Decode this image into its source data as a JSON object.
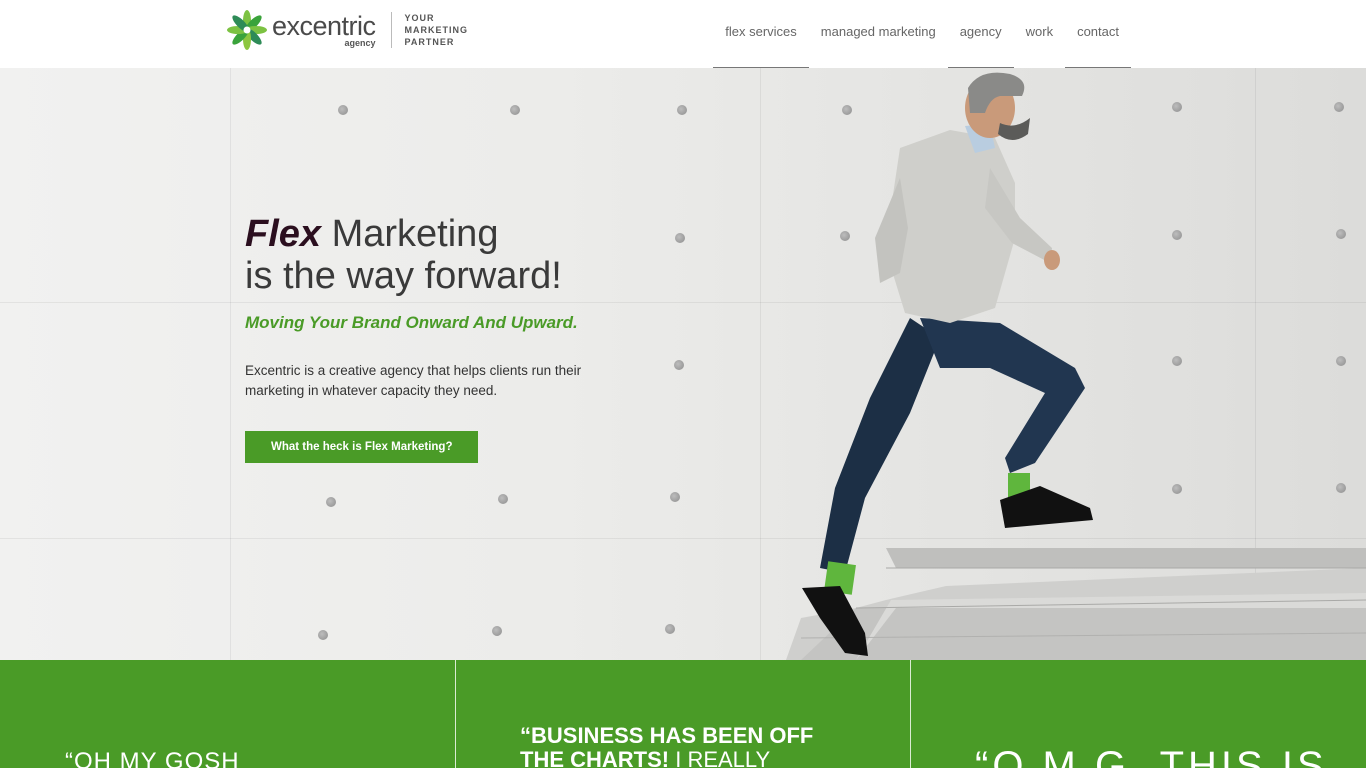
{
  "header": {
    "logo_text": "excentric",
    "logo_sub": "agency",
    "tagline": [
      "YOUR",
      "MARKETING",
      "PARTNER"
    ],
    "nav": [
      {
        "label": "flex services"
      },
      {
        "label": "managed marketing"
      },
      {
        "label": "agency"
      },
      {
        "label": "work"
      },
      {
        "label": "contact"
      }
    ]
  },
  "hero": {
    "title_emphasis": "Flex",
    "title_rest": " Marketing",
    "title_line2": "is the way forward!",
    "subtitle": "Moving Your Brand Onward And Upward.",
    "description": "Excentric is a creative agency that helps clients run their marketing in whatever capacity they need.",
    "cta_label": "What the heck is Flex Marketing?"
  },
  "testimonials": [
    {
      "text": "“OH MY GOSH"
    },
    {
      "bold": "“BUSINESS HAS BEEN OFF THE CHARTS!",
      "rest": " I REALLY"
    },
    {
      "text": "“O.M.G. THIS IS"
    }
  ],
  "colors": {
    "brand_green": "#4a9b27",
    "title_dark": "#2b0f1f"
  }
}
